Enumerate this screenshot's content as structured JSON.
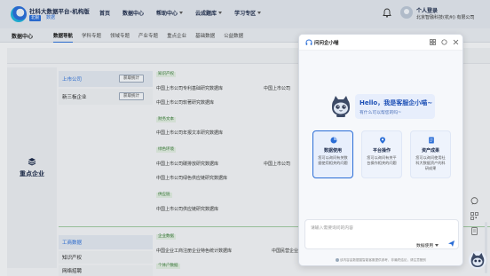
{
  "header": {
    "title": "社科大数据平台-机构版",
    "badge": "北银",
    "badge_sub": "数据",
    "nav": [
      {
        "label": "首页",
        "caret": false
      },
      {
        "label": "数据中心",
        "caret": false
      },
      {
        "label": "帮助中心",
        "caret": true
      },
      {
        "label": "云成题库",
        "caret": true
      },
      {
        "label": "学习专区",
        "caret": true
      }
    ],
    "user_name": "个人登录",
    "user_org": "北京智融科技(杭州) 有限公司"
  },
  "subnav": {
    "title": "数据中心",
    "tabs": [
      {
        "label": "数据导航",
        "active": true
      },
      {
        "label": "学科专题",
        "active": false
      },
      {
        "label": "领域专题",
        "active": false
      },
      {
        "label": "产业专题",
        "active": false
      },
      {
        "label": "重点企业",
        "active": false
      },
      {
        "label": "基础数据",
        "active": false
      },
      {
        "label": "公益数据",
        "active": false
      }
    ]
  },
  "content": {
    "category": "重点企业",
    "subcategories": [
      {
        "label": "上市公司",
        "button": "获取统计"
      },
      {
        "label": "新三板企业",
        "button": "获取统计"
      },
      {
        "label": "工商数据",
        "button": ""
      },
      {
        "label": "知识产权",
        "button": ""
      },
      {
        "label": "网络招聘",
        "button": ""
      }
    ],
    "groups": [
      {
        "tag": "知识产权",
        "items": [
          "中国上市公司专利基础研究数据库",
          "中国上市公司"
        ]
      },
      {
        "tag": "",
        "items": [
          "中国上市公司软著研究数据库"
        ]
      },
      {
        "tag": "财务文本",
        "items": [
          "中国上市公司年报文本研究数据库"
        ]
      },
      {
        "tag": "绿色环境",
        "items": [
          "中国上市公司碳排放研究数据库",
          "中国上市公司"
        ]
      },
      {
        "tag": "",
        "items": [
          "中国上市公司绿色供应链研究数据库"
        ]
      },
      {
        "tag": "供应链",
        "items": [
          "中国上市公司供应链研究数据库"
        ]
      },
      {
        "tag": "企业数据",
        "items": [
          "中国企业工商注册企业特色统计数据库",
          "中国民营企业"
        ]
      },
      {
        "tag": "个体户数据",
        "items": []
      }
    ]
  },
  "chat": {
    "title": "问问企小喵",
    "greeting": "Hello，我是客服企小喵~",
    "greeting_sub": "有什么可以帮您的吗~",
    "cards": [
      {
        "title": "数据使用",
        "desc": "您可以询问有关数据使用相关的问题",
        "icon": "pie-chart-icon",
        "active": true
      },
      {
        "title": "平台操作",
        "desc": "您可以询问有关平台操作相关的问题",
        "icon": "location-pin-icon",
        "active": false
      },
      {
        "title": "资产成果",
        "desc": "您可以询问使用社科大数据资产的科研成果",
        "icon": "document-icon",
        "active": false
      }
    ],
    "input_placeholder": "请输入需要询问的内容",
    "mode_label": "数据使用",
    "footer": "该内容由数据猫智能客服提供参考，非最终结论，请注意甄别"
  },
  "colors": {
    "accent": "#2a6dd6",
    "bubble_bg": "#e7eefc"
  }
}
